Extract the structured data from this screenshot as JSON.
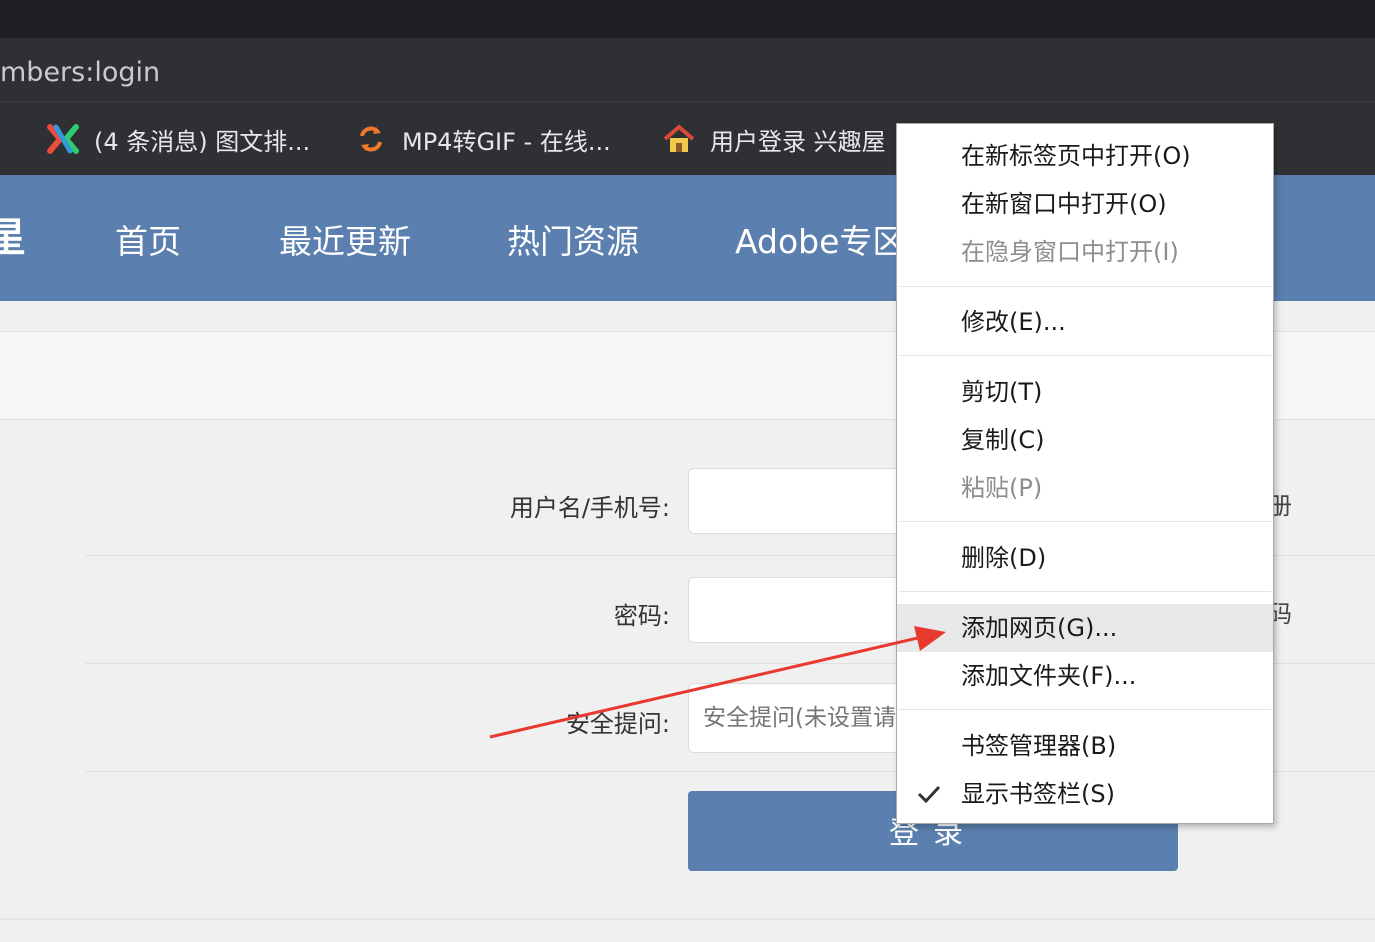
{
  "browser": {
    "url": "mbers:login",
    "bookmarks": [
      {
        "label": "(4 条消息) 图文排...",
        "icon": "x-logo-icon"
      },
      {
        "label": "MP4转GIF - 在线...",
        "icon": "convert-arrows-icon"
      },
      {
        "label": "用户登录 兴趣屋",
        "icon": "house-icon"
      }
    ]
  },
  "site": {
    "logo_fragment": "星",
    "nav": [
      "首页",
      "最近更新",
      "热门资源",
      "Adobe专区"
    ]
  },
  "form": {
    "username_label": "用户名/手机号:",
    "password_label": "密码:",
    "hint_label": "安全提问:",
    "hint_placeholder": "安全提问(未设置请",
    "right_fragment_1": "册",
    "right_fragment_2": "码",
    "login_button": "登录"
  },
  "context_menu": {
    "items": [
      {
        "label": "在新标签页中打开(O)",
        "disabled": false
      },
      {
        "label": "在新窗口中打开(O)",
        "disabled": false
      },
      {
        "label": "在隐身窗口中打开(I)",
        "disabled": true
      },
      {
        "label": "修改(E)...",
        "disabled": false
      },
      {
        "label": "剪切(T)",
        "disabled": false
      },
      {
        "label": "复制(C)",
        "disabled": false
      },
      {
        "label": "粘贴(P)",
        "disabled": true
      },
      {
        "label": "删除(D)",
        "disabled": false
      },
      {
        "label": "添加网页(G)...",
        "disabled": false,
        "highlighted": true
      },
      {
        "label": "添加文件夹(F)...",
        "disabled": false
      },
      {
        "label": "书签管理器(B)",
        "disabled": false
      },
      {
        "label": "显示书签栏(S)",
        "disabled": false,
        "checked": true
      }
    ]
  },
  "colors": {
    "nav_bg": "#5b7fae",
    "annotation_arrow": "#e8392f",
    "browser_chrome": "#2e3033"
  }
}
